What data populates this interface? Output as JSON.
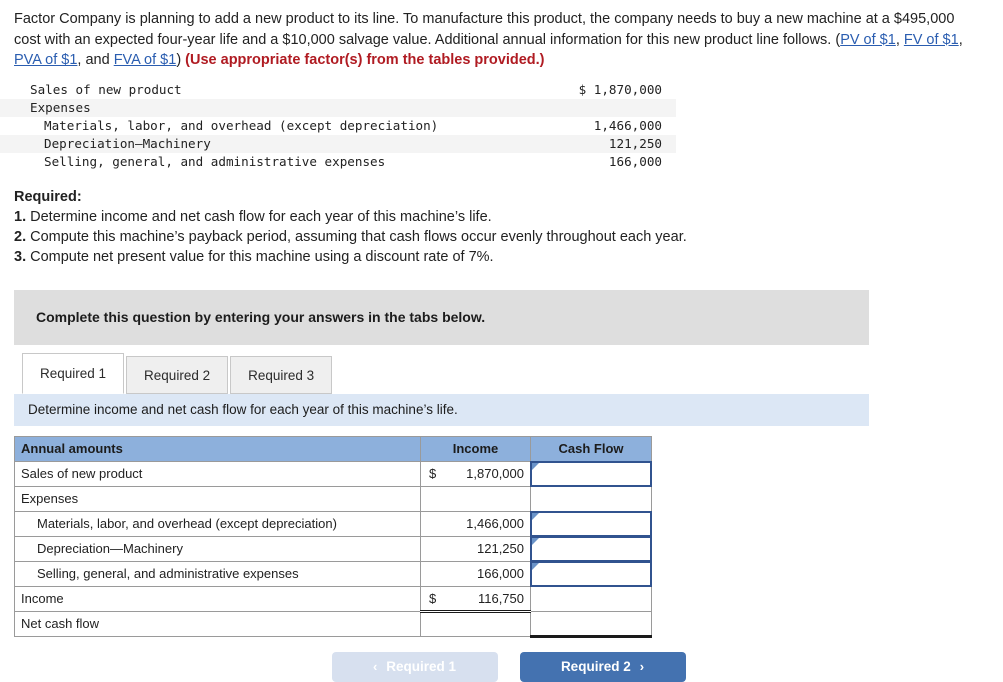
{
  "problem": {
    "part1": "Factor Company is planning to add a new product to its line. To manufacture this product, the company needs to buy a new machine at a $495,000 cost with an expected four-year life and a $10,000 salvage value. Additional annual information for this new product line follows. (",
    "link_pv": "PV of $1",
    "sep1": ", ",
    "link_fv": "FV of $1",
    "sep2": ", ",
    "link_pva": "PVA of $1",
    "sep3": ", and ",
    "link_fva": "FVA of $1",
    "close_paren": ") ",
    "emphasis": "(Use appropriate factor(s) from the tables provided.)"
  },
  "given_table": {
    "rows": [
      {
        "label": "Sales of new product",
        "amount": "$ 1,870,000",
        "shaded": false,
        "indent": false
      },
      {
        "label": "Expenses",
        "amount": "",
        "shaded": true,
        "indent": false
      },
      {
        "label": "Materials, labor, and overhead (except depreciation)",
        "amount": "1,466,000",
        "shaded": false,
        "indent": true
      },
      {
        "label": "Depreciation–Machinery",
        "amount": "121,250",
        "shaded": true,
        "indent": true
      },
      {
        "label": "Selling, general, and administrative expenses",
        "amount": "166,000",
        "shaded": false,
        "indent": true
      }
    ]
  },
  "required": {
    "heading": "Required:",
    "items": [
      {
        "num": "1.",
        "text": "Determine income and net cash flow for each year of this machine’s life."
      },
      {
        "num": "2.",
        "text": "Compute this machine’s payback period, assuming that cash flows occur evenly throughout each year."
      },
      {
        "num": "3.",
        "text": "Compute net present value for this machine using a discount rate of 7%."
      }
    ]
  },
  "grey_banner": {
    "text": "Complete this question by entering your answers in the tabs below."
  },
  "tabs": [
    {
      "label": "Required 1",
      "active": true
    },
    {
      "label": "Required 2",
      "active": false
    },
    {
      "label": "Required 3",
      "active": false
    }
  ],
  "blue_banner": {
    "text": "Determine income and net cash flow for each year of this machine’s life."
  },
  "answer_table": {
    "headers": {
      "label": "Annual amounts",
      "income": "Income",
      "cash_flow": "Cash Flow"
    },
    "rows": [
      {
        "label": "Sales of new product",
        "indent": false,
        "income_currency": "$",
        "income": "1,870,000",
        "income_double": false,
        "cash_input": true,
        "cash_value": "",
        "cash_thick": false
      },
      {
        "label": "Expenses",
        "indent": false,
        "income_currency": "",
        "income": "",
        "income_double": false,
        "cash_input": false,
        "cash_value": "",
        "cash_thick": false
      },
      {
        "label": "Materials, labor, and overhead (except depreciation)",
        "indent": true,
        "income_currency": "",
        "income": "1,466,000",
        "income_double": false,
        "cash_input": true,
        "cash_value": "",
        "cash_thick": false
      },
      {
        "label": "Depreciation—Machinery",
        "indent": true,
        "income_currency": "",
        "income": "121,250",
        "income_double": false,
        "cash_input": true,
        "cash_value": "",
        "cash_thick": false
      },
      {
        "label": "Selling, general, and administrative expenses",
        "indent": true,
        "income_currency": "",
        "income": "166,000",
        "income_double": false,
        "cash_input": true,
        "cash_value": "",
        "cash_thick": false
      },
      {
        "label": "Income",
        "indent": false,
        "income_currency": "$",
        "income": "116,750",
        "income_double": true,
        "cash_input": false,
        "cash_value": "",
        "cash_thick": false
      },
      {
        "label": "Net cash flow",
        "indent": false,
        "income_currency": "",
        "income": "",
        "income_double": false,
        "cash_input": false,
        "cash_value": "",
        "cash_thick": true
      }
    ]
  },
  "nav": {
    "prev_label": "Required 1",
    "prev_chevron": "‹",
    "next_label": "Required 2",
    "next_chevron": "›"
  },
  "colors": {
    "accent_blue": "#4472b0",
    "header_blue": "#8db0dc",
    "info_blue": "#dce7f5",
    "banner_grey": "#dedede",
    "link_blue": "#2a5db0",
    "emphasis_red": "#b01b22",
    "input_border": "#31538f"
  }
}
